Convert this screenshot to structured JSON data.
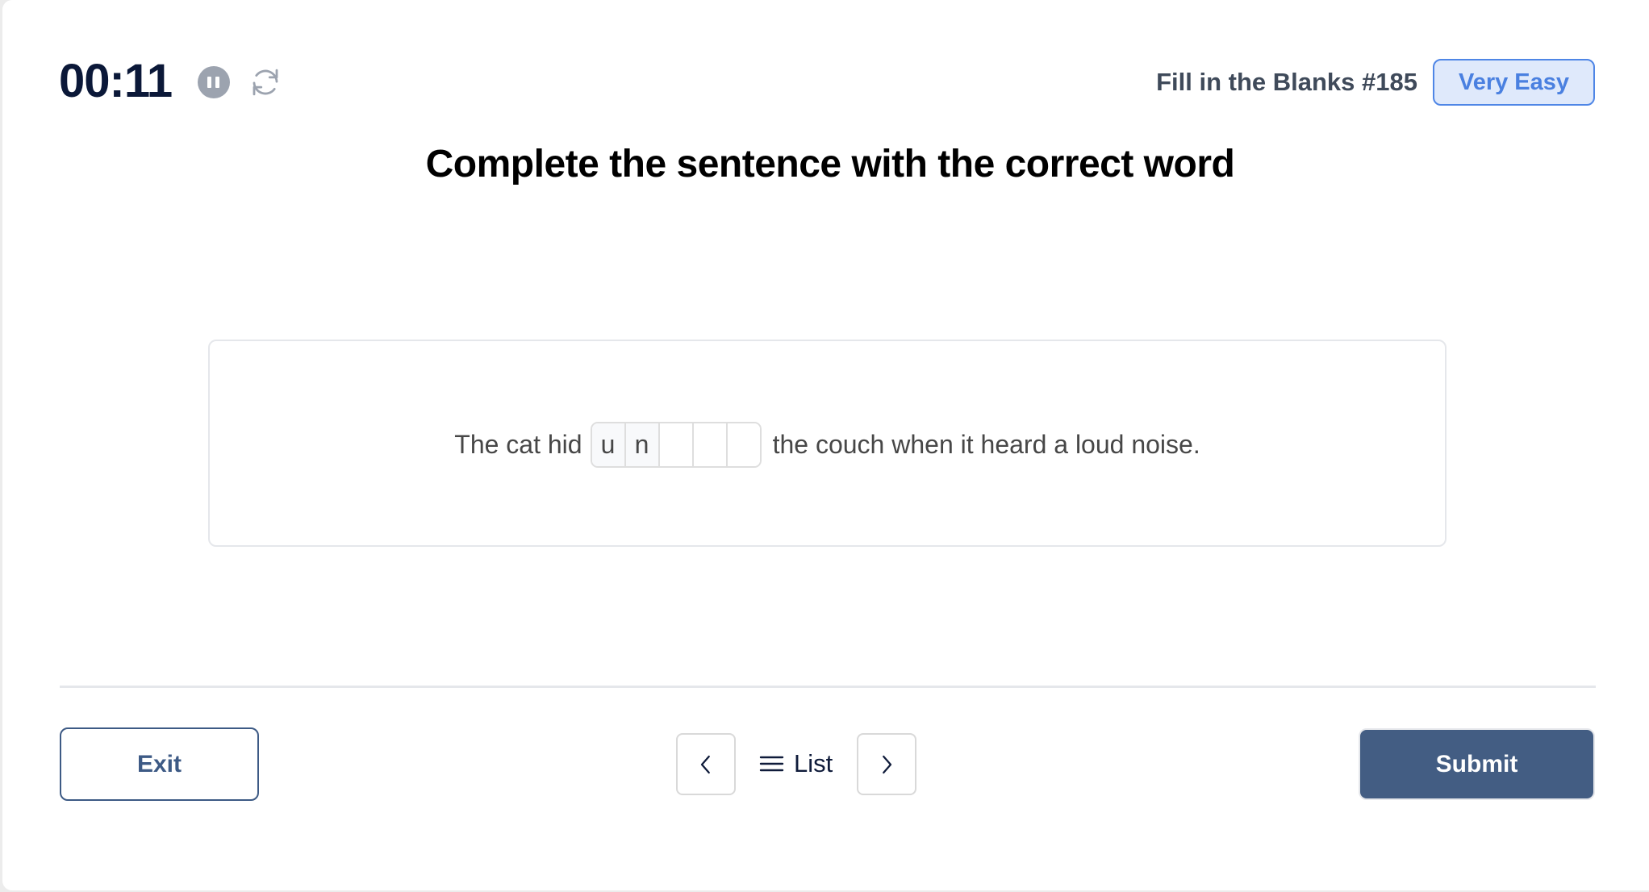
{
  "header": {
    "timer": "00:11",
    "pause_icon": "pause-circle-icon",
    "restart_icon": "refresh-icon",
    "game_title": "Fill in the Blanks #185",
    "difficulty": "Very Easy"
  },
  "prompt": {
    "heading": "Complete the sentence with the correct word"
  },
  "question": {
    "before_text": "The cat hid",
    "after_text": "the couch when it heard a loud noise.",
    "letters": [
      "u",
      "n",
      "",
      "",
      ""
    ],
    "letter_count": 5
  },
  "footer": {
    "exit_label": "Exit",
    "prev_icon": "chevron-left-icon",
    "list_icon": "list-icon",
    "list_label": "List",
    "next_icon": "chevron-right-icon",
    "submit_label": "Submit"
  },
  "colors": {
    "primary": "#435d83",
    "badge_accent": "#4f86e6",
    "badge_bg": "#dfe9fb",
    "timer_text": "#0b1838"
  }
}
